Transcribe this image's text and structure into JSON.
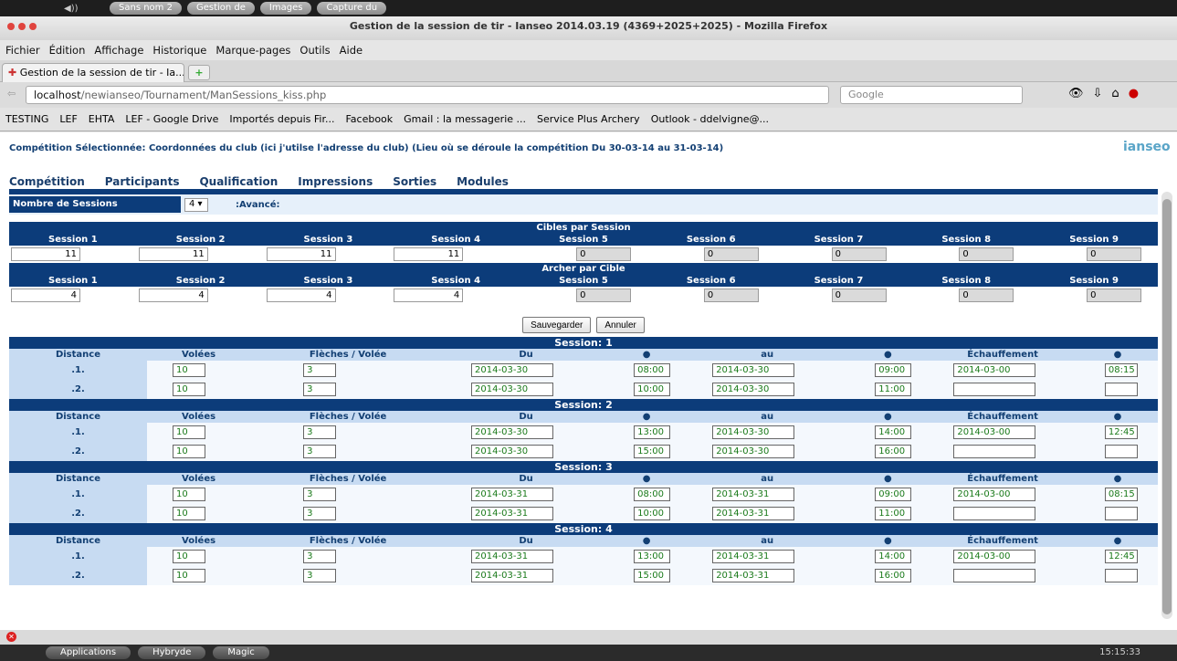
{
  "system_bar": {
    "tasks": [
      "Sans nom 2",
      "Gestion de",
      "Images",
      "Capture du"
    ]
  },
  "window": {
    "title": "Gestion de la session de tir - Ianseo 2014.03.19 (4369+2025+2025) - Mozilla Firefox"
  },
  "menu": [
    "Fichier",
    "Édition",
    "Affichage",
    "Historique",
    "Marque-pages",
    "Outils",
    "Aide"
  ],
  "tab": {
    "label": "Gestion de la session de tir - Ia..."
  },
  "url": {
    "host": "localhost",
    "path": "/newianseo/Tournament/ManSessions_kiss.php"
  },
  "search": {
    "placeholder": "Google"
  },
  "bookmarks": [
    "TESTING",
    "LEF",
    "EHTA",
    "LEF - Google Drive",
    "Importés depuis Fir...",
    "Facebook",
    "Gmail : la messagerie ...",
    "Service Plus Archery",
    "Outlook - ddelvigne@..."
  ],
  "page": {
    "competition_header": "Compétition Sélectionnée: Coordonnées du club (ici j'utilse l'adresse du club) (Lieu où se déroule la compétition Du 30-03-14 au 31-03-14)",
    "logo": "ianseo",
    "main_menu": [
      "Compétition",
      "Participants",
      "Qualification",
      "Impressions",
      "Sorties",
      "Modules"
    ],
    "nb_sessions_label": "Nombre de Sessions",
    "nb_sessions_value": "4",
    "avance_label": ":Avancé:",
    "targets_title": "Cibles par Session",
    "archers_title": "Archer par Cible",
    "session_headers": [
      "Session 1",
      "Session 2",
      "Session 3",
      "Session 4",
      "Session 5",
      "Session 6",
      "Session 7",
      "Session 8",
      "Session 9"
    ],
    "targets": [
      "11",
      "11",
      "11",
      "11",
      "0",
      "0",
      "0",
      "0",
      "0"
    ],
    "archers": [
      "4",
      "4",
      "4",
      "4",
      "0",
      "0",
      "0",
      "0",
      "0"
    ],
    "save_label": "Sauvegarder",
    "cancel_label": "Annuler",
    "col_headers": [
      "Distance",
      "Volées",
      "Flèches / Volée",
      "Du",
      "●",
      "au",
      "●",
      "Échauffement",
      "●"
    ],
    "sessions": [
      {
        "title": "Session: 1",
        "rows": [
          {
            "dist": ".1.",
            "volees": "10",
            "fleches": "3",
            "du": "2014-03-30",
            "t1": "08:00",
            "au": "2014-03-30",
            "t2": "09:00",
            "ech": "2014-03-00",
            "t3": "08:15"
          },
          {
            "dist": ".2.",
            "volees": "10",
            "fleches": "3",
            "du": "2014-03-30",
            "t1": "10:00",
            "au": "2014-03-30",
            "t2": "11:00",
            "ech": "",
            "t3": ""
          }
        ]
      },
      {
        "title": "Session: 2",
        "rows": [
          {
            "dist": ".1.",
            "volees": "10",
            "fleches": "3",
            "du": "2014-03-30",
            "t1": "13:00",
            "au": "2014-03-30",
            "t2": "14:00",
            "ech": "2014-03-00",
            "t3": "12:45"
          },
          {
            "dist": ".2.",
            "volees": "10",
            "fleches": "3",
            "du": "2014-03-30",
            "t1": "15:00",
            "au": "2014-03-30",
            "t2": "16:00",
            "ech": "",
            "t3": ""
          }
        ]
      },
      {
        "title": "Session: 3",
        "rows": [
          {
            "dist": ".1.",
            "volees": "10",
            "fleches": "3",
            "du": "2014-03-31",
            "t1": "08:00",
            "au": "2014-03-31",
            "t2": "09:00",
            "ech": "2014-03-00",
            "t3": "08:15"
          },
          {
            "dist": ".2.",
            "volees": "10",
            "fleches": "3",
            "du": "2014-03-31",
            "t1": "10:00",
            "au": "2014-03-31",
            "t2": "11:00",
            "ech": "",
            "t3": ""
          }
        ]
      },
      {
        "title": "Session: 4",
        "rows": [
          {
            "dist": ".1.",
            "volees": "10",
            "fleches": "3",
            "du": "2014-03-31",
            "t1": "13:00",
            "au": "2014-03-31",
            "t2": "14:00",
            "ech": "2014-03-00",
            "t3": "12:45"
          },
          {
            "dist": ".2.",
            "volees": "10",
            "fleches": "3",
            "du": "2014-03-31",
            "t1": "15:00",
            "au": "2014-03-31",
            "t2": "16:00",
            "ech": "",
            "t3": ""
          }
        ]
      }
    ]
  },
  "dock": [
    "Applications",
    "Hybryde",
    "Magic"
  ],
  "clock": "15:15:33"
}
